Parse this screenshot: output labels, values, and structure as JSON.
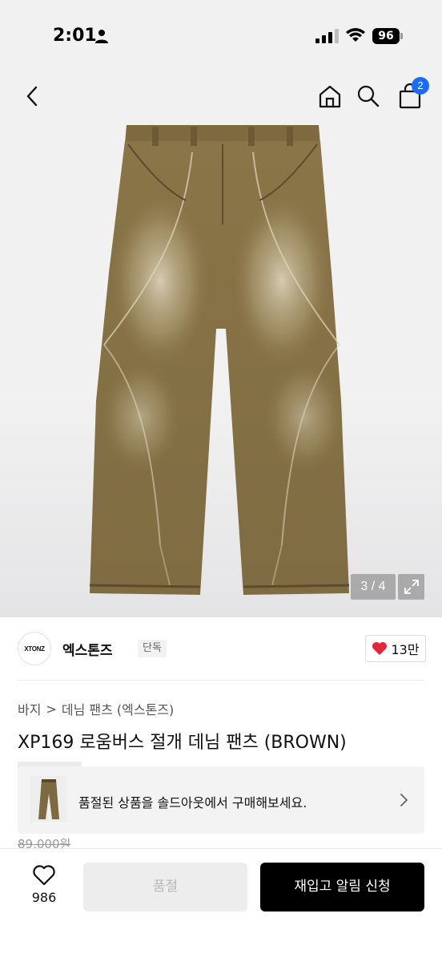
{
  "status_bar": {
    "time": "2:01",
    "battery": "96"
  },
  "header": {
    "cart_count": "2"
  },
  "gallery": {
    "counter": "3 / 4"
  },
  "brand": {
    "logo_text": "XTONZ",
    "name": "엑스톤즈",
    "tag": "단독",
    "likes": "13만"
  },
  "breadcrumb": {
    "level1": "바지",
    "separator": ">",
    "level2": "데님 팬츠 (엑스톤즈)"
  },
  "product": {
    "title": "XP169 로움버스 절개 데님 팬츠 (BROWN)",
    "original_price": "89,000원"
  },
  "soldout_banner": {
    "text": "품절된 상품을 솔드아웃에서 구매해보세요."
  },
  "bottom_bar": {
    "wish_count": "986",
    "soldout_label": "품절",
    "restock_label": "재입고 알림 신청"
  },
  "colors": {
    "badge": "#1a6bff",
    "like_heart": "#e8233a",
    "denim": "#8a7647"
  }
}
